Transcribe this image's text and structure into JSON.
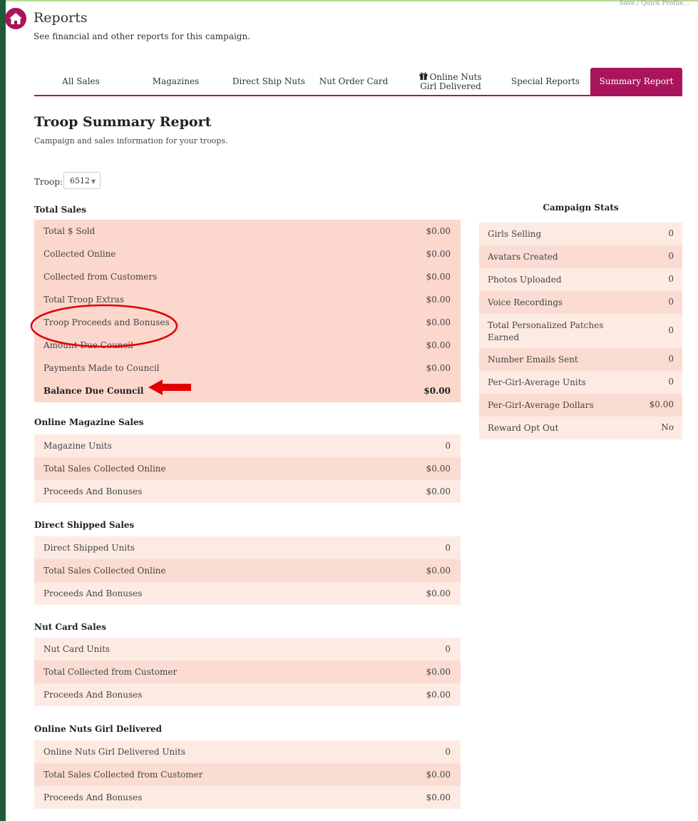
{
  "header": {
    "title": "Reports",
    "subtitle": "See financial and other reports for this campaign.",
    "top_right": "Save / Quick Profile..."
  },
  "tabs": [
    {
      "label": "All Sales",
      "active": false
    },
    {
      "label": "Magazines",
      "active": false
    },
    {
      "label": "Direct Ship Nuts",
      "active": false
    },
    {
      "label": "Nut Order Card",
      "active": false
    },
    {
      "label": "Online Nuts",
      "label2": "Girl Delivered",
      "active": false,
      "icon": "gift-icon"
    },
    {
      "label": "Special Reports",
      "active": false
    },
    {
      "label": "Summary Report",
      "active": true
    }
  ],
  "report": {
    "title": "Troop Summary Report",
    "subtitle": "Campaign and sales information for your troops.",
    "troop_label": "Troop:",
    "troop_value": "6512"
  },
  "total_sales": {
    "title": "Total Sales",
    "rows": [
      {
        "label": "Total $ Sold",
        "value": "$0.00"
      },
      {
        "label": "Collected Online",
        "value": "$0.00"
      },
      {
        "label": "Collected from Customers",
        "value": "$0.00"
      },
      {
        "label": "Total Troop Extras",
        "value": "$0.00"
      },
      {
        "label": "Troop Proceeds and Bonuses",
        "value": "$0.00"
      },
      {
        "label": "Amount Due Council",
        "value": "$0.00"
      },
      {
        "label": "Payments Made to Council",
        "value": "$0.00"
      },
      {
        "label": "Balance Due Council",
        "value": "$0.00"
      }
    ]
  },
  "online_magazine": {
    "title": "Online Magazine Sales",
    "rows": [
      {
        "label": "Magazine Units",
        "value": "0"
      },
      {
        "label": "Total Sales Collected Online",
        "value": "$0.00"
      },
      {
        "label": "Proceeds And Bonuses",
        "value": "$0.00"
      }
    ]
  },
  "direct_shipped": {
    "title": "Direct Shipped Sales",
    "rows": [
      {
        "label": "Direct Shipped Units",
        "value": "0"
      },
      {
        "label": "Total Sales Collected Online",
        "value": "$0.00"
      },
      {
        "label": "Proceeds And Bonuses",
        "value": "$0.00"
      }
    ]
  },
  "nut_card": {
    "title": "Nut Card Sales",
    "rows": [
      {
        "label": "Nut Card Units",
        "value": "0"
      },
      {
        "label": "Total Collected from Customer",
        "value": "$0.00"
      },
      {
        "label": "Proceeds And Bonuses",
        "value": "$0.00"
      }
    ]
  },
  "online_nuts": {
    "title": "Online Nuts Girl Delivered",
    "rows": [
      {
        "label": "Online Nuts Girl Delivered Units",
        "value": "0"
      },
      {
        "label": "Total Sales Collected from Customer",
        "value": "$0.00"
      },
      {
        "label": "Proceeds And Bonuses",
        "value": "$0.00"
      }
    ]
  },
  "campaign_stats": {
    "title": "Campaign Stats",
    "rows": [
      {
        "label": "Girls Selling",
        "value": "0"
      },
      {
        "label": "Avatars Created",
        "value": "0"
      },
      {
        "label": "Photos Uploaded",
        "value": "0"
      },
      {
        "label": "Voice Recordings",
        "value": "0"
      },
      {
        "label": "Total Personalized Patches Earned",
        "value": "0"
      },
      {
        "label": "Number Emails Sent",
        "value": "0"
      },
      {
        "label": "Per-Girl-Average Units",
        "value": "0"
      },
      {
        "label": "Per-Girl-Average Dollars",
        "value": "$0.00"
      },
      {
        "label": "Reward Opt Out",
        "value": "No"
      }
    ]
  },
  "colors": {
    "brand": "#a8155a",
    "sidebar": "#1f5a3a",
    "annotation": "#e00000"
  }
}
